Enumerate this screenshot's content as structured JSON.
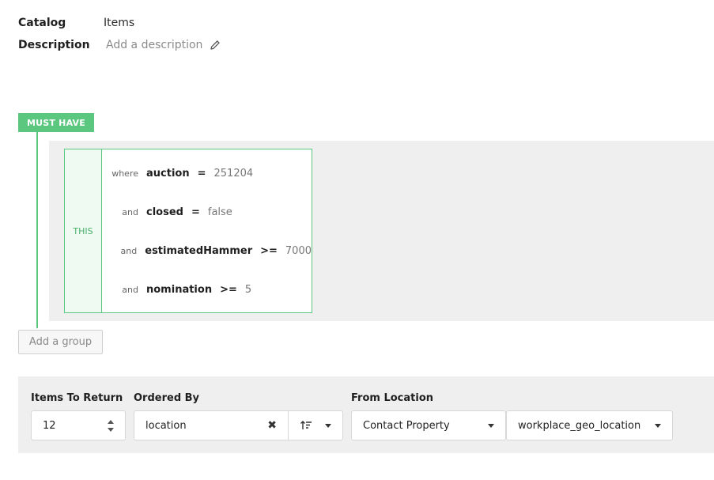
{
  "meta": {
    "catalog_label": "Catalog",
    "catalog_value": "Items",
    "description_label": "Description",
    "description_placeholder": "Add a description"
  },
  "group": {
    "badge": "MUST HAVE",
    "this_label": "THIS",
    "conditions": [
      {
        "conj": "where",
        "field": "auction",
        "op": "=",
        "value": "251204"
      },
      {
        "conj": "and",
        "field": "closed",
        "op": "=",
        "value": "false"
      },
      {
        "conj": "and",
        "field": "estimatedHammer",
        "op": ">=",
        "value": "7000"
      },
      {
        "conj": "and",
        "field": "nomination",
        "op": ">=",
        "value": "5"
      }
    ],
    "add_group_label": "Add a group"
  },
  "options": {
    "items_to_return_label": "Items To Return",
    "items_to_return_value": "12",
    "ordered_by_label": "Ordered By",
    "ordered_by_value": "location",
    "from_location_label": "From Location",
    "from_location_source": "Contact Property",
    "from_location_property": "workplace_geo_location"
  },
  "colors": {
    "accent": "#5cc77f",
    "panel": "#efefef"
  },
  "icons": {
    "description_edit": "pencil-icon",
    "sort_direction": "sort-ascending-icon",
    "clear": "close-icon"
  }
}
